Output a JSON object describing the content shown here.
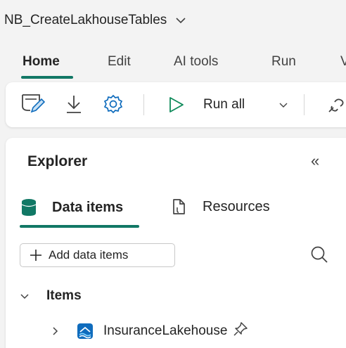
{
  "window": {
    "title": "NB_CreateLakhouseTables"
  },
  "tabs": [
    {
      "label": "Home",
      "active": true
    },
    {
      "label": "Edit"
    },
    {
      "label": "AI tools"
    },
    {
      "label": "Run"
    },
    {
      "label": "V"
    }
  ],
  "toolbar": {
    "run_all_label": "Run all",
    "icons": [
      "notebook-edit-icon",
      "download-icon",
      "settings-icon",
      "play-icon",
      "chevron-down-icon",
      "connect-icon"
    ]
  },
  "explorer": {
    "title": "Explorer",
    "collapse_glyph": "«",
    "subtabs": [
      {
        "label": "Data items",
        "active": true
      },
      {
        "label": "Resources"
      }
    ],
    "add_button_label": "Add data items",
    "tree": {
      "group_label": "Items",
      "children": [
        {
          "label": "InsuranceLakehouse"
        }
      ]
    }
  },
  "colors": {
    "accent": "#117865",
    "icon_blue": "#0f6cbd",
    "play_green": "#0e8a5a"
  }
}
